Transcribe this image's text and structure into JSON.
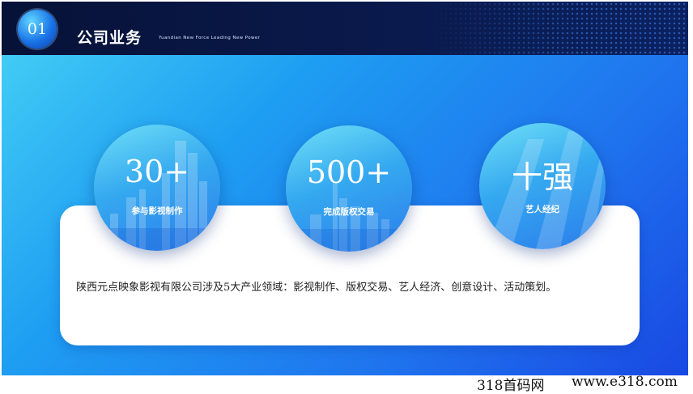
{
  "header": {
    "badge": "01",
    "title": "公司业务",
    "subtitle": "Yuandian New Force Leading New Power"
  },
  "stats": [
    {
      "value": "30+",
      "label": "参与影视制作"
    },
    {
      "value": "500+",
      "label": "完成版权交易"
    },
    {
      "value": "十强",
      "label": "艺人经纪"
    }
  ],
  "description": "陕西元点映象影视有限公司涉及5大产业领域：影视制作、版权交易、艺人经济、创意设计、活动策划。",
  "watermark": {
    "left": "318首码网",
    "right": "www.e318.com"
  }
}
